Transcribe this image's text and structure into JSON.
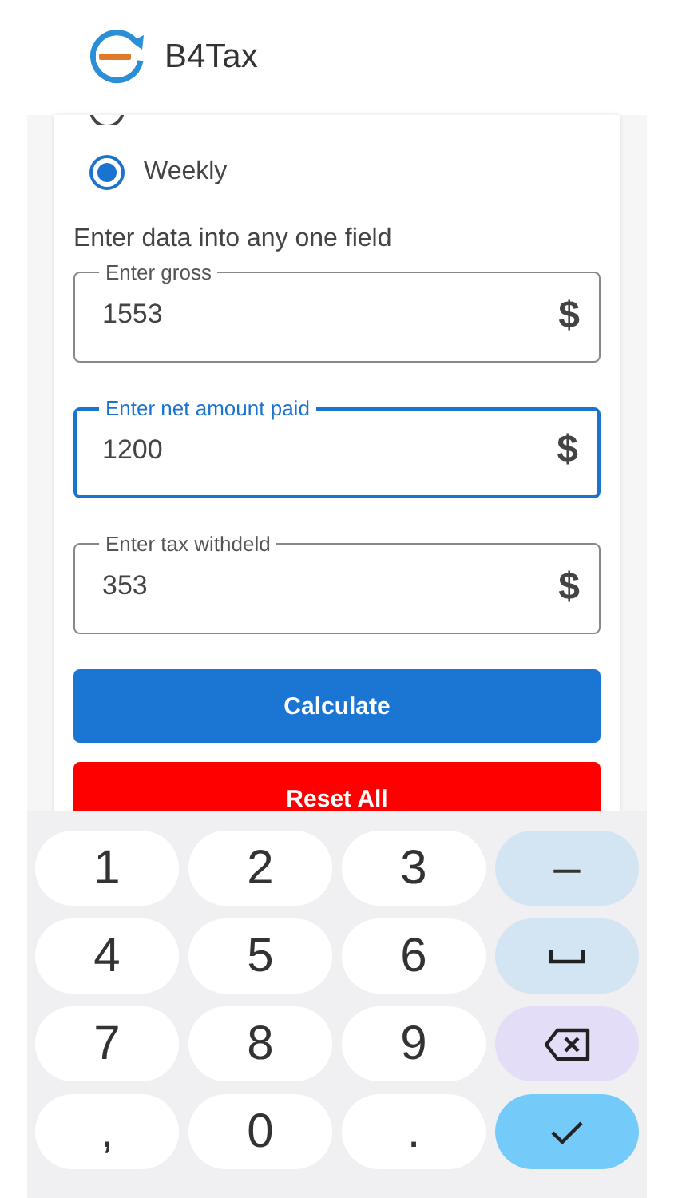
{
  "app_bar": {
    "title": "B4Tax"
  },
  "partial_option": {
    "selected": false
  },
  "options": [
    {
      "label": "Weekly",
      "selected": true
    }
  ],
  "instruction": "Enter data into any one field",
  "fields": [
    {
      "label": "Enter gross",
      "value": "1553",
      "suffix": "$",
      "focused": false
    },
    {
      "label": "Enter net amount paid",
      "value": "1200",
      "suffix": "$",
      "focused": true
    },
    {
      "label": "Enter tax withdeld",
      "value": "353",
      "suffix": "$",
      "focused": false
    }
  ],
  "buttons": [
    {
      "label": "Calculate",
      "kind": "primary"
    },
    {
      "label": "Reset All",
      "kind": "danger"
    }
  ],
  "keyboard": [
    {
      "kind": "text",
      "label": "1"
    },
    {
      "kind": "text",
      "label": "2"
    },
    {
      "kind": "text",
      "label": "3"
    },
    {
      "kind": "symbol",
      "label": "–"
    },
    {
      "kind": "text",
      "label": "4"
    },
    {
      "kind": "text",
      "label": "5"
    },
    {
      "kind": "text",
      "label": "6"
    },
    {
      "kind": "space"
    },
    {
      "kind": "text",
      "label": "7"
    },
    {
      "kind": "text",
      "label": "8"
    },
    {
      "kind": "text",
      "label": "9"
    },
    {
      "kind": "backspace"
    },
    {
      "kind": "text",
      "label": ","
    },
    {
      "kind": "text",
      "label": "0"
    },
    {
      "kind": "text",
      "label": "."
    },
    {
      "kind": "done"
    }
  ]
}
